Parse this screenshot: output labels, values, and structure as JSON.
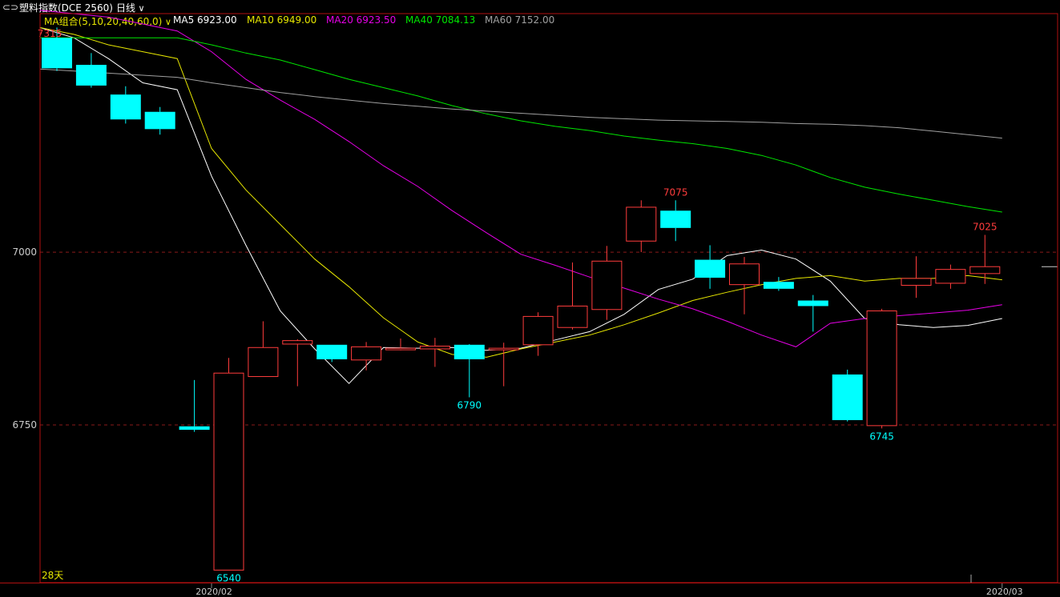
{
  "header": {
    "window_icon": "link-icon",
    "instrument": "塑料指数(DCE 2560)",
    "period": "日线",
    "period_icon": "chevron-down-icon"
  },
  "legend": {
    "ma_group": "MA组合(5,10,20,40,60,0)",
    "ma_group_icon": "chevron-down-icon",
    "items": [
      {
        "label": "MA5 6923.00",
        "color": "#ffffff"
      },
      {
        "label": "MA10 6949.00",
        "color": "#e6e600"
      },
      {
        "label": "MA20 6923.50",
        "color": "#e600e6"
      },
      {
        "label": "MA40 7084.13",
        "color": "#00e600"
      },
      {
        "label": "MA60 7152.00",
        "color": "#a0a0a0"
      }
    ]
  },
  "colors": {
    "background": "#000000",
    "up": "#ff3c3c",
    "down": "#00ffff",
    "frame": "#b01010",
    "grid": "#8a1a1a",
    "axis_text": "#cccccc"
  },
  "chart_data": {
    "type": "candlestick",
    "ylim": [
      6530,
      7350
    ],
    "yticks": [
      7000,
      6750
    ],
    "x_labels": [
      {
        "label": "2020/02",
        "at_index": 5
      },
      {
        "label": "2020/03",
        "at_index": 28
      }
    ],
    "bottom_left_label": "28天",
    "candles": [
      {
        "open": 7310,
        "high": 7325,
        "low": 7262,
        "close": 7266
      },
      {
        "open": 7271,
        "high": 7288,
        "low": 7238,
        "close": 7241
      },
      {
        "open": 7228,
        "high": 7240,
        "low": 7186,
        "close": 7192
      },
      {
        "open": 7203,
        "high": 7210,
        "low": 7170,
        "close": 7178
      },
      {
        "open": 6748,
        "high": 6815,
        "low": 6740,
        "close": 6743
      },
      {
        "open": 6540,
        "high": 6847,
        "low": 6540,
        "close": 6825
      },
      {
        "open": 6820,
        "high": 6900,
        "low": 6820,
        "close": 6862
      },
      {
        "open": 6867,
        "high": 6874,
        "low": 6806,
        "close": 6872
      },
      {
        "open": 6866,
        "high": 6866,
        "low": 6841,
        "close": 6845
      },
      {
        "open": 6844,
        "high": 6870,
        "low": 6829,
        "close": 6863
      },
      {
        "open": 6861,
        "high": 6875,
        "low": 6858,
        "close": 6861
      },
      {
        "open": 6860,
        "high": 6876,
        "low": 6834,
        "close": 6864
      },
      {
        "open": 6866,
        "high": 6867,
        "low": 6790,
        "close": 6845
      },
      {
        "open": 6859,
        "high": 6869,
        "low": 6806,
        "close": 6861
      },
      {
        "open": 6866,
        "high": 6913,
        "low": 6850,
        "close": 6907
      },
      {
        "open": 6891,
        "high": 6985,
        "low": 6888,
        "close": 6922
      },
      {
        "open": 6917,
        "high": 7009,
        "low": 6902,
        "close": 6987
      },
      {
        "open": 7016,
        "high": 7075,
        "low": 7000,
        "close": 7065
      },
      {
        "open": 7060,
        "high": 7075,
        "low": 7016,
        "close": 7035
      },
      {
        "open": 6989,
        "high": 7010,
        "low": 6947,
        "close": 6963
      },
      {
        "open": 6953,
        "high": 6993,
        "low": 6910,
        "close": 6983
      },
      {
        "open": 6957,
        "high": 6964,
        "low": 6944,
        "close": 6947
      },
      {
        "open": 6930,
        "high": 6938,
        "low": 6885,
        "close": 6922
      },
      {
        "open": 6823,
        "high": 6830,
        "low": 6755,
        "close": 6757
      },
      {
        "open": 6749,
        "high": 6918,
        "low": 6745,
        "close": 6915
      },
      {
        "open": 6952,
        "high": 6994,
        "low": 6934,
        "close": 6962
      },
      {
        "open": 6955,
        "high": 6982,
        "low": 6947,
        "close": 6975
      },
      {
        "open": 6969,
        "high": 7025,
        "low": 6954,
        "close": 6979
      }
    ],
    "ma_lines": [
      {
        "name": "MA5",
        "color": "#ffffff",
        "values": [
          7325,
          7310,
          7280,
          7245,
          7235,
          7110,
          7010,
          6915,
          6860,
          6810,
          6862,
          6861,
          6862,
          6858,
          6861,
          6873,
          6885,
          6910,
          6946,
          6961,
          6995,
          7003,
          6990,
          6958,
          6904,
          6895,
          6891,
          6894,
          6904
        ]
      },
      {
        "name": "MA10",
        "color": "#e6e600",
        "values": [
          7325,
          7315,
          7300,
          7290,
          7280,
          7150,
          7090,
          7040,
          6990,
          6950,
          6905,
          6870,
          6852,
          6848,
          6860,
          6870,
          6880,
          6895,
          6912,
          6930,
          6942,
          6953,
          6962,
          6966,
          6958,
          6962,
          6962,
          6966,
          6960
        ]
      },
      {
        "name": "MA20",
        "color": "#e600e6",
        "values": [
          7350,
          7345,
          7340,
          7330,
          7320,
          7290,
          7250,
          7220,
          7192,
          7160,
          7125,
          7095,
          7060,
          7028,
          6997,
          6981,
          6964,
          6948,
          6932,
          6918,
          6900,
          6880,
          6863,
          6897,
          6904,
          6908,
          6912,
          6916,
          6924
        ]
      },
      {
        "name": "MA40",
        "color": "#00e600",
        "values": [
          7310,
          7310,
          7310,
          7310,
          7310,
          7300,
          7288,
          7278,
          7264,
          7250,
          7238,
          7226,
          7212,
          7200,
          7190,
          7182,
          7176,
          7168,
          7162,
          7157,
          7150,
          7140,
          7126,
          7108,
          7094,
          7084,
          7075,
          7066,
          7058
        ]
      },
      {
        "name": "MA60",
        "color": "#a0a0a0",
        "values": [
          7265,
          7262,
          7259,
          7256,
          7253,
          7245,
          7238,
          7231,
          7225,
          7220,
          7215,
          7211,
          7207,
          7204,
          7201,
          7198,
          7195,
          7193,
          7191,
          7190,
          7189,
          7188,
          7186,
          7185,
          7183,
          7180,
          7175,
          7170,
          7165
        ]
      }
    ],
    "annotations": [
      {
        "text": "7315",
        "value": 7315,
        "at_index": 0,
        "color": "#ff3c3c"
      },
      {
        "text": "6540",
        "value": 6540,
        "at_index": 5,
        "color": "#00ffff"
      },
      {
        "text": "6790",
        "value": 6790,
        "at_index": 12,
        "color": "#00ffff"
      },
      {
        "text": "7075",
        "value": 7075,
        "at_index": 18,
        "color": "#ff3c3c"
      },
      {
        "text": "6745",
        "value": 6745,
        "at_index": 24,
        "color": "#00ffff"
      },
      {
        "text": "7025",
        "value": 7025,
        "at_index": 27,
        "color": "#ff3c3c"
      }
    ],
    "current_price": 6979
  }
}
